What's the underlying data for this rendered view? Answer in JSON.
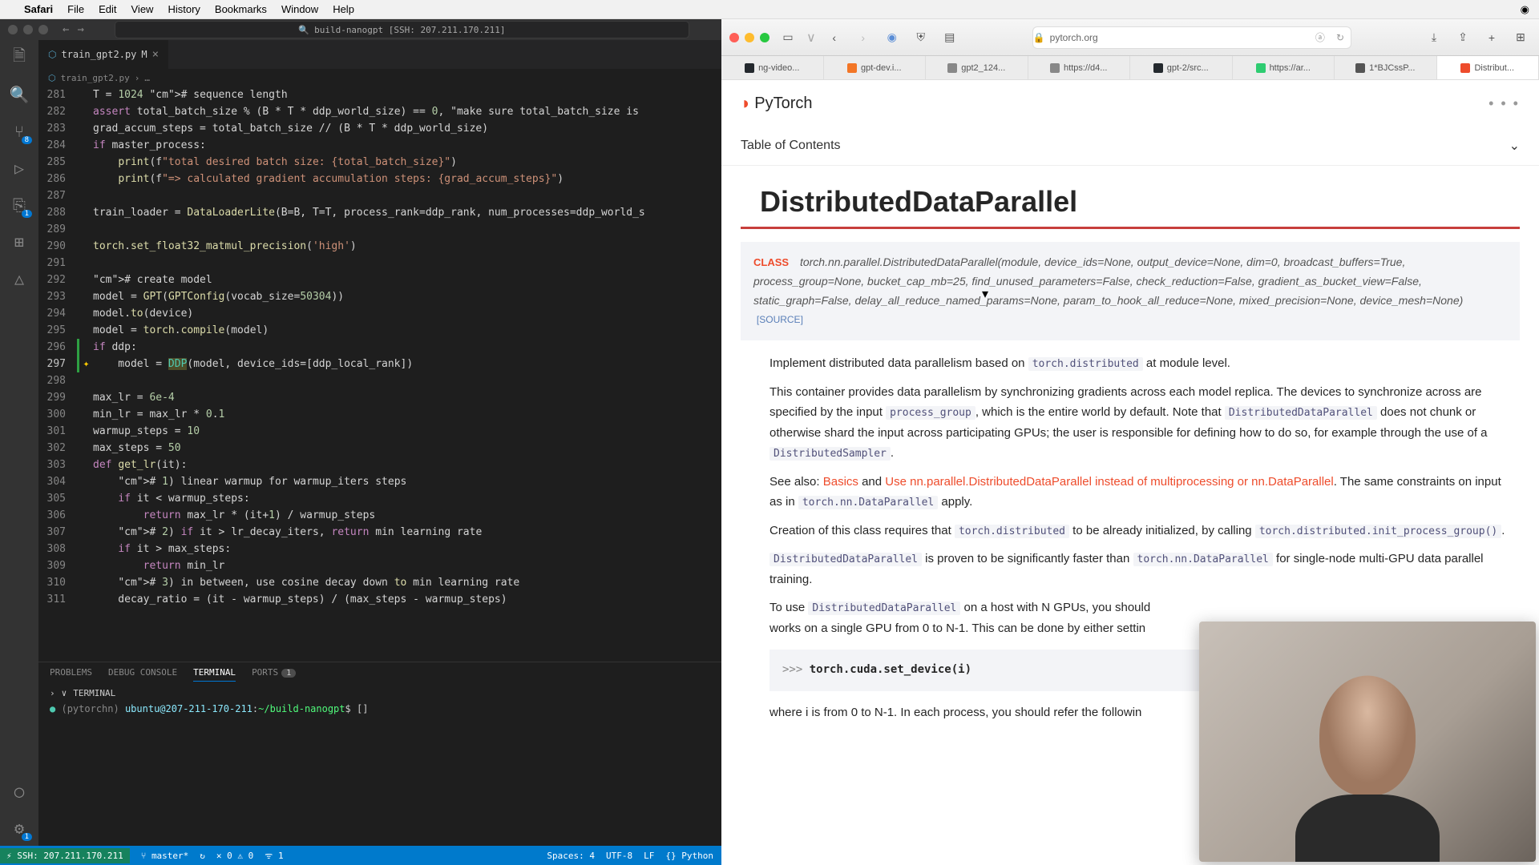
{
  "menubar": {
    "apple": "",
    "app": "Safari",
    "items": [
      "File",
      "Edit",
      "View",
      "History",
      "Bookmarks",
      "Window",
      "Help"
    ]
  },
  "vscode": {
    "title_search": "build-nanogpt [SSH: 207.211.170.211]",
    "tab": {
      "name": "train_gpt2.py",
      "modified": "M"
    },
    "breadcrumb": {
      "file": "train_gpt2.py",
      "more": "…"
    },
    "terminal": {
      "tabs": {
        "problems": "PROBLEMS",
        "debug": "DEBUG CONSOLE",
        "terminal": "TERMINAL",
        "ports": "PORTS",
        "ports_badge": "1"
      },
      "label": "TERMINAL",
      "env": "(pytorchn)",
      "host": "ubuntu@207-211-170-211",
      "path": "~/build-nanogpt",
      "prompt": "$",
      "cursor": "[]"
    },
    "status": {
      "ssh": "SSH: 207.211.170.211",
      "branch": "master*",
      "sync": "↻",
      "errs": "✕ 0  ⚠ 0",
      "signal": "ᯤ 1",
      "spaces": "Spaces: 4",
      "enc": "UTF-8",
      "eol": "LF",
      "lang": "{} Python"
    },
    "code": [
      {
        "n": 281,
        "t": "T = 1024 # sequence length"
      },
      {
        "n": 282,
        "t": "assert total_batch_size % (B * T * ddp_world_size) == 0, \"make sure total_batch_size is"
      },
      {
        "n": 283,
        "t": "grad_accum_steps = total_batch_size // (B * T * ddp_world_size)"
      },
      {
        "n": 284,
        "t": "if master_process:"
      },
      {
        "n": 285,
        "t": "    print(f\"total desired batch size: {total_batch_size}\")"
      },
      {
        "n": 286,
        "t": "    print(f\"=> calculated gradient accumulation steps: {grad_accum_steps}\")"
      },
      {
        "n": 287,
        "t": ""
      },
      {
        "n": 288,
        "t": "train_loader = DataLoaderLite(B=B, T=T, process_rank=ddp_rank, num_processes=ddp_world_s"
      },
      {
        "n": 289,
        "t": ""
      },
      {
        "n": 290,
        "t": "torch.set_float32_matmul_precision('high')"
      },
      {
        "n": 291,
        "t": ""
      },
      {
        "n": 292,
        "t": "# create model"
      },
      {
        "n": 293,
        "t": "model = GPT(GPTConfig(vocab_size=50304))"
      },
      {
        "n": 294,
        "t": "model.to(device)"
      },
      {
        "n": 295,
        "t": "model = torch.compile(model)"
      },
      {
        "n": 296,
        "t": "if ddp:",
        "mod": true
      },
      {
        "n": 297,
        "t": "    model = DDP(model, device_ids=[ddp_local_rank])",
        "mod": true,
        "hl": true
      },
      {
        "n": 298,
        "t": ""
      },
      {
        "n": 299,
        "t": "max_lr = 6e-4"
      },
      {
        "n": 300,
        "t": "min_lr = max_lr * 0.1"
      },
      {
        "n": 301,
        "t": "warmup_steps = 10"
      },
      {
        "n": 302,
        "t": "max_steps = 50"
      },
      {
        "n": 303,
        "t": "def get_lr(it):"
      },
      {
        "n": 304,
        "t": "    # 1) linear warmup for warmup_iters steps"
      },
      {
        "n": 305,
        "t": "    if it < warmup_steps:"
      },
      {
        "n": 306,
        "t": "        return max_lr * (it+1) / warmup_steps"
      },
      {
        "n": 307,
        "t": "    # 2) if it > lr_decay_iters, return min learning rate"
      },
      {
        "n": 308,
        "t": "    if it > max_steps:"
      },
      {
        "n": 309,
        "t": "        return min_lr"
      },
      {
        "n": 310,
        "t": "    # 3) in between, use cosine decay down to min learning rate"
      },
      {
        "n": 311,
        "t": "    decay_ratio = (it - warmup_steps) / (max_steps - warmup_steps)"
      }
    ]
  },
  "safari": {
    "url": "pytorch.org",
    "lock": "🔒",
    "tabs": [
      "ng-video...",
      "gpt-dev.i...",
      "gpt2_124...",
      "https://d4...",
      "gpt-2/src...",
      "https://ar...",
      "1*BJCssP...",
      "Distribut..."
    ],
    "tab_icons": [
      "#24292e",
      "#f37626",
      "#888",
      "#888",
      "#24292e",
      "#2ecc71",
      "#555",
      "#ee4c2c"
    ],
    "active_tab": 7,
    "brand": "PyTorch",
    "toc": "Table of Contents",
    "h1": "DistributedDataParallel",
    "class_label": "CLASS",
    "signature": "torch.nn.parallel.DistributedDataParallel(module, device_ids=None, output_device=None, dim=0, broadcast_buffers=True, process_group=None, bucket_cap_mb=25, find_unused_parameters=False, check_reduction=False, gradient_as_bucket_view=False, static_graph=False, delay_all_reduce_named_params=None, param_to_hook_all_reduce=None, mixed_precision=None, device_mesh=None)",
    "source": "[SOURCE]",
    "para1_a": "Implement distributed data parallelism based on ",
    "para1_code": "torch.distributed",
    "para1_b": " at module level.",
    "para2_a": "This container provides data parallelism by synchronizing gradients across each model replica. The devices to synchronize across are specified by the input ",
    "para2_c1": "process_group",
    "para2_b": ", which is the entire world by default. Note that ",
    "para2_c2": "DistributedDataParallel",
    "para2_c": " does not chunk or otherwise shard the input across participating GPUs; the user is responsible for defining how to do so, for example through the use of a ",
    "para2_c3": "DistributedSampler",
    "para2_d": ".",
    "para3_a": "See also: ",
    "para3_l1": "Basics",
    "para3_and": " and ",
    "para3_l2": "Use nn.parallel.DistributedDataParallel instead of multiprocessing or nn.DataParallel",
    "para3_b": ". The same constraints on input as in ",
    "para3_c1": "torch.nn.DataParallel",
    "para3_c": " apply.",
    "para4_a": "Creation of this class requires that ",
    "para4_c1": "torch.distributed",
    "para4_b": " to be already initialized, by calling ",
    "para4_c2": "torch.distributed.init_process_group()",
    "para4_c": ".",
    "para5_c1": "DistributedDataParallel",
    "para5_a": " is proven to be significantly faster than ",
    "para5_c2": "torch.nn.DataParallel",
    "para5_b": " for single-node multi-GPU data parallel training.",
    "para6_a": "To use ",
    "para6_c1": "DistributedDataParallel",
    "para6_b": " on a host with N GPUs, you should",
    "para6_c": "works on a single GPU from 0 to N-1. This can be done by either settin",
    "codeblk_prompt": ">>> ",
    "codeblk": "torch.cuda.set_device(i)",
    "para7": "where i is from 0 to N-1. In each process, you should refer the followin"
  }
}
